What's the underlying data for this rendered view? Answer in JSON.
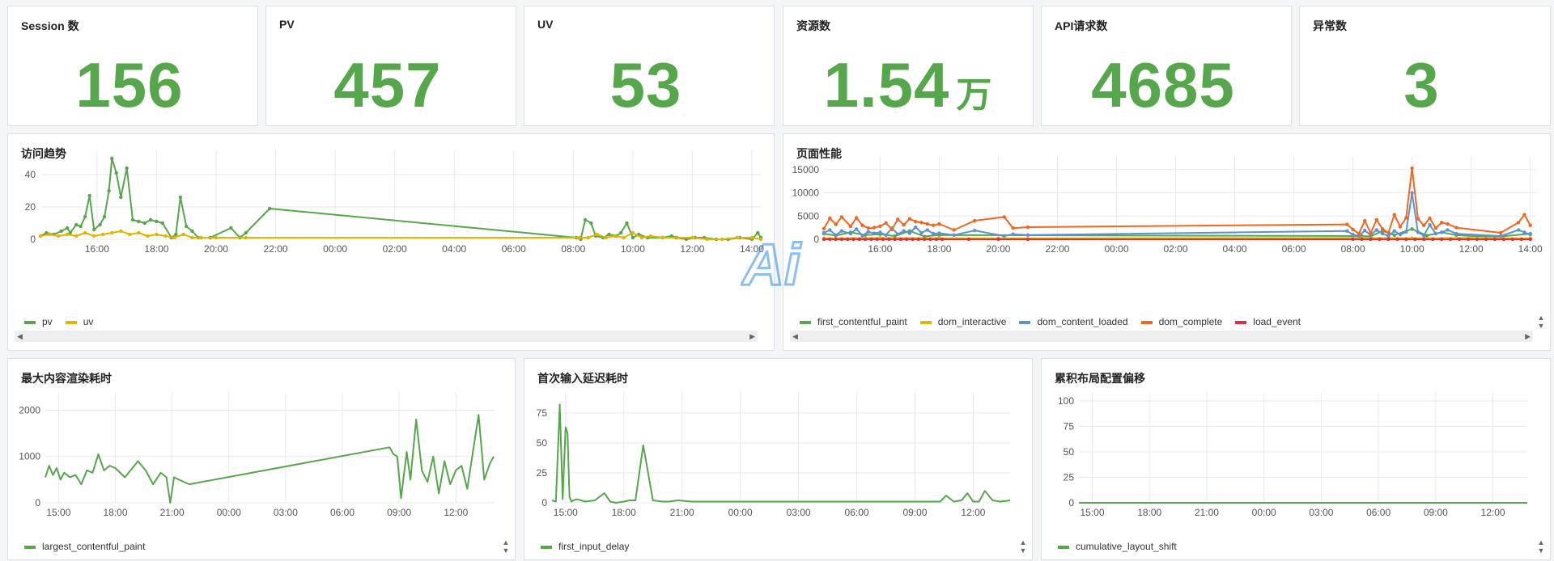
{
  "stats": [
    {
      "title": "Session 数",
      "value": "156",
      "unit": ""
    },
    {
      "title": "PV",
      "value": "457",
      "unit": ""
    },
    {
      "title": "UV",
      "value": "53",
      "unit": ""
    },
    {
      "title": "资源数",
      "value": "1.54",
      "unit": "万"
    },
    {
      "title": "API请求数",
      "value": "4685",
      "unit": ""
    },
    {
      "title": "异常数",
      "value": "3",
      "unit": ""
    }
  ],
  "colors": {
    "green": "#56a64b",
    "yellow": "#e0b400",
    "blue": "#5b92d6",
    "orange": "#f2661f",
    "red": "#e02f44",
    "panel_border": "#dcdfe3",
    "grid": "#e6e6e6"
  },
  "panels": {
    "visit": {
      "title": "访问趋势"
    },
    "perf": {
      "title": "页面性能"
    },
    "lcp": {
      "title": "最大内容渲染耗时"
    },
    "fid": {
      "title": "首次输入延迟耗时"
    },
    "cls": {
      "title": "累积布局配置偏移"
    }
  },
  "watermark": {
    "text": "Ai"
  },
  "chart_data": [
    {
      "id": "visit",
      "type": "line",
      "title": "访问趋势",
      "xlabel": "",
      "ylabel": "",
      "ylim": [
        0,
        50
      ],
      "yticks": [
        0,
        20,
        40
      ],
      "xtick_labels": [
        "16:00",
        "18:00",
        "20:00",
        "22:00",
        "00:00",
        "02:00",
        "04:00",
        "06:00",
        "08:00",
        "10:00",
        "12:00",
        "14:00"
      ],
      "xtick_hours": [
        16,
        18,
        20,
        22,
        24,
        26,
        28,
        30,
        32,
        34,
        36,
        38
      ],
      "xlim_hours": [
        14.1,
        38.3
      ],
      "legend": "bottom-left",
      "series": [
        {
          "name": "pv",
          "color": "#56a64b",
          "x": [
            14.1,
            14.3,
            14.55,
            14.8,
            15.0,
            15.1,
            15.3,
            15.45,
            15.6,
            15.75,
            15.9,
            16.1,
            16.25,
            16.4,
            16.5,
            16.65,
            16.8,
            17.0,
            17.2,
            17.4,
            17.6,
            17.8,
            18.0,
            18.2,
            18.5,
            18.65,
            18.8,
            19.0,
            19.2,
            19.4,
            19.8,
            20.5,
            20.8,
            21.0,
            21.8,
            32.1,
            32.25,
            32.4,
            32.6,
            32.75,
            33.0,
            33.2,
            33.45,
            33.6,
            33.8,
            34.0,
            34.2,
            34.5,
            35.0,
            35.3,
            35.45,
            35.8,
            36.1,
            36.4,
            36.8,
            37.2,
            37.6,
            38.0,
            38.2,
            38.3
          ],
          "y": [
            2,
            4,
            3,
            5,
            7,
            4,
            9,
            8,
            14,
            27,
            6,
            9,
            14,
            30,
            50,
            41,
            26,
            44,
            12,
            11,
            10,
            12,
            11,
            10,
            1,
            3,
            26,
            8,
            5,
            1,
            1,
            7,
            1,
            4,
            19,
            1,
            0,
            12,
            10,
            2,
            1,
            3,
            2,
            4,
            10,
            1,
            3,
            1,
            1,
            2,
            1,
            0,
            1,
            1,
            0,
            0,
            1,
            0,
            4,
            1
          ]
        },
        {
          "name": "uv",
          "color": "#e0b400",
          "x": [
            14.1,
            14.4,
            14.7,
            15.0,
            15.3,
            15.6,
            15.9,
            16.2,
            16.5,
            16.8,
            17.1,
            17.4,
            17.7,
            18.0,
            18.3,
            18.6,
            18.9,
            19.2,
            19.5,
            20.0,
            21.0,
            32.2,
            32.5,
            32.8,
            33.1,
            33.4,
            33.7,
            34.0,
            34.3,
            34.6,
            35.0,
            35.5,
            36.0,
            36.5,
            37.0,
            37.5,
            38.0,
            38.3
          ],
          "y": [
            2,
            3,
            2,
            3,
            2,
            4,
            2,
            3,
            4,
            5,
            3,
            4,
            2,
            3,
            2,
            1,
            3,
            1,
            1,
            1,
            1,
            1,
            1,
            3,
            1,
            2,
            1,
            4,
            1,
            2,
            1,
            1,
            1,
            0,
            0,
            1,
            1,
            0
          ]
        }
      ]
    },
    {
      "id": "perf",
      "type": "line",
      "title": "页面性能",
      "xlabel": "",
      "ylabel": "",
      "ylim": [
        0,
        16000
      ],
      "yticks": [
        0,
        5000,
        10000,
        15000
      ],
      "xtick_labels": [
        "16:00",
        "18:00",
        "20:00",
        "22:00",
        "00:00",
        "02:00",
        "04:00",
        "06:00",
        "08:00",
        "10:00",
        "12:00",
        "14:00"
      ],
      "xtick_hours": [
        16,
        18,
        20,
        22,
        24,
        26,
        28,
        30,
        32,
        34,
        36,
        38
      ],
      "xlim_hours": [
        14.1,
        38.2
      ],
      "legend": "bottom-left",
      "series": [
        {
          "name": "first_contentful_paint",
          "color": "#56a64b",
          "x": [
            14.1,
            14.5,
            15.0,
            15.5,
            16.0,
            16.5,
            17.0,
            17.5,
            18.0,
            32.3,
            32.6,
            33.0,
            33.4,
            34.0,
            34.5,
            35.0,
            35.5,
            36.0,
            37.0,
            38.0
          ],
          "y": [
            1200,
            800,
            1500,
            900,
            1100,
            700,
            1800,
            600,
            900,
            700,
            600,
            1800,
            900,
            2200,
            800,
            1500,
            900,
            700,
            600,
            1200
          ]
        },
        {
          "name": "dom_interactive",
          "color": "#e0b400",
          "x": [
            14.1,
            16.0,
            18.0,
            20.0,
            32.3,
            34.0,
            36.0,
            38.0
          ],
          "y": [
            200,
            300,
            250,
            200,
            300,
            250,
            300,
            200
          ]
        },
        {
          "name": "dom_content_loaded",
          "color": "#5b92d6",
          "x": [
            14.1,
            14.3,
            14.5,
            14.7,
            15.0,
            15.2,
            15.4,
            15.6,
            15.8,
            16.0,
            16.2,
            16.4,
            16.6,
            16.8,
            17.0,
            17.2,
            17.4,
            17.6,
            17.8,
            18.0,
            18.5,
            19.2,
            20.2,
            20.5,
            21.0,
            31.8,
            32.0,
            32.2,
            32.4,
            32.6,
            32.8,
            33.0,
            33.2,
            33.4,
            33.6,
            33.8,
            34.0,
            34.2,
            34.4,
            34.6,
            34.8,
            35.0,
            35.2,
            35.5,
            37.0,
            37.6,
            37.8,
            38.0
          ],
          "y": [
            1400,
            2000,
            900,
            1800,
            1200,
            2200,
            800,
            1600,
            1300,
            1500,
            900,
            2400,
            1100,
            1800,
            1300,
            2600,
            1400,
            2000,
            1200,
            1300,
            900,
            1900,
            700,
            1100,
            900,
            1800,
            1000,
            700,
            1900,
            900,
            2000,
            1200,
            700,
            1800,
            1000,
            1600,
            10000,
            1500,
            800,
            3100,
            1200,
            1500,
            2000,
            1200,
            700,
            2000,
            1500,
            1000
          ]
        },
        {
          "name": "dom_complete",
          "color": "#f2661f",
          "x": [
            14.1,
            14.3,
            14.5,
            14.7,
            15.0,
            15.2,
            15.4,
            15.6,
            15.8,
            16.0,
            16.2,
            16.4,
            16.6,
            16.8,
            17.0,
            17.2,
            17.4,
            17.6,
            17.8,
            18.0,
            18.5,
            19.2,
            20.2,
            20.5,
            21.0,
            31.8,
            32.0,
            32.2,
            32.4,
            32.6,
            32.8,
            33.0,
            33.2,
            33.4,
            33.6,
            33.8,
            34.0,
            34.2,
            34.4,
            34.6,
            34.8,
            35.0,
            35.2,
            35.5,
            37.0,
            37.6,
            37.8,
            38.0
          ],
          "y": [
            2300,
            4500,
            3200,
            4800,
            2800,
            4600,
            3000,
            2400,
            2500,
            2800,
            3500,
            2100,
            4300,
            3100,
            4400,
            3800,
            3600,
            3300,
            3000,
            3300,
            2000,
            4000,
            4800,
            2400,
            2600,
            3200,
            2100,
            1200,
            4000,
            1300,
            4200,
            2200,
            1400,
            5300,
            2700,
            4600,
            15300,
            4400,
            3000,
            4500,
            2400,
            3600,
            3300,
            2500,
            1400,
            3600,
            5300,
            3000
          ]
        },
        {
          "name": "load_event",
          "color": "#e02f44",
          "x": [
            14.1,
            14.3,
            14.5,
            14.7,
            14.9,
            15.1,
            15.3,
            15.5,
            15.7,
            15.9,
            16.1,
            16.3,
            16.5,
            16.7,
            16.9,
            17.1,
            17.3,
            17.5,
            17.7,
            17.9,
            18.1,
            19.0,
            20.0,
            21.0,
            32.0,
            32.3,
            32.6,
            32.9,
            33.2,
            33.5,
            33.8,
            34.1,
            34.4,
            34.7,
            35.0,
            35.3,
            35.6,
            35.9,
            36.2,
            36.5,
            36.8,
            37.1,
            37.4,
            37.7,
            38.0
          ],
          "y": [
            0,
            0,
            0,
            0,
            0,
            0,
            0,
            0,
            0,
            0,
            0,
            0,
            0,
            0,
            0,
            0,
            0,
            0,
            0,
            0,
            0,
            0,
            0,
            0,
            0,
            0,
            0,
            0,
            0,
            0,
            0,
            0,
            0,
            0,
            0,
            0,
            0,
            0,
            0,
            0,
            0,
            0,
            0,
            0,
            0
          ]
        }
      ]
    },
    {
      "id": "lcp",
      "type": "line",
      "title": "最大内容渲染耗时",
      "xlabel": "",
      "ylabel": "",
      "ylim": [
        0,
        2200
      ],
      "yticks": [
        0,
        1000,
        2000
      ],
      "xtick_labels": [
        "15:00",
        "18:00",
        "21:00",
        "00:00",
        "03:00",
        "06:00",
        "09:00",
        "12:00"
      ],
      "xtick_hours": [
        15,
        18,
        21,
        24,
        27,
        30,
        33,
        36
      ],
      "xlim_hours": [
        14.3,
        38.0
      ],
      "legend": "bottom-left",
      "series": [
        {
          "name": "largest_contentful_paint",
          "color": "#56a64b",
          "x": [
            14.3,
            14.5,
            14.7,
            14.9,
            15.1,
            15.3,
            15.6,
            15.9,
            16.2,
            16.5,
            16.8,
            17.1,
            17.4,
            17.7,
            18.0,
            18.5,
            19.2,
            19.6,
            20.0,
            20.4,
            20.7,
            20.9,
            21.1,
            21.9,
            32.5,
            32.7,
            32.9,
            33.1,
            33.4,
            33.6,
            33.9,
            34.2,
            34.5,
            34.8,
            35.1,
            35.4,
            35.7,
            36.0,
            36.3,
            36.6,
            37.2,
            37.5,
            37.8,
            38.0
          ],
          "y": [
            550,
            800,
            600,
            750,
            500,
            650,
            550,
            600,
            400,
            700,
            650,
            1050,
            700,
            800,
            750,
            550,
            900,
            700,
            400,
            650,
            550,
            0,
            550,
            400,
            1200,
            1050,
            1000,
            100,
            1100,
            500,
            1800,
            700,
            450,
            1000,
            200,
            900,
            400,
            700,
            800,
            300,
            1900,
            500,
            850,
            1000
          ]
        }
      ]
    },
    {
      "id": "fid",
      "type": "line",
      "title": "首次输入延迟耗时",
      "xlabel": "",
      "ylabel": "",
      "ylim": [
        0,
        85
      ],
      "yticks": [
        0,
        25,
        50,
        75
      ],
      "xtick_labels": [
        "15:00",
        "18:00",
        "21:00",
        "00:00",
        "03:00",
        "06:00",
        "09:00",
        "12:00"
      ],
      "xtick_hours": [
        15,
        18,
        21,
        24,
        27,
        30,
        33,
        36
      ],
      "xlim_hours": [
        14.3,
        37.9
      ],
      "legend": "bottom-left",
      "series": [
        {
          "name": "first_input_delay",
          "color": "#56a64b",
          "x": [
            14.3,
            14.5,
            14.7,
            14.85,
            15.0,
            15.1,
            15.2,
            15.3,
            15.4,
            15.6,
            16.0,
            16.5,
            17.0,
            17.3,
            17.6,
            18.0,
            18.3,
            18.6,
            19.0,
            19.5,
            20.0,
            20.3,
            20.8,
            21.5,
            34.0,
            34.3,
            34.6,
            35.0,
            35.4,
            35.7,
            36.0,
            36.3,
            36.6,
            37.0,
            37.4,
            37.9
          ],
          "y": [
            2,
            1,
            82,
            3,
            63,
            58,
            5,
            1,
            2,
            3,
            1,
            2,
            8,
            1,
            0,
            1,
            2,
            2,
            48,
            2,
            1,
            1,
            2,
            1,
            1,
            1,
            6,
            1,
            2,
            8,
            1,
            1,
            10,
            2,
            1,
            2
          ]
        }
      ]
    },
    {
      "id": "cls",
      "type": "line",
      "title": "累积布局配置偏移",
      "xlabel": "",
      "ylabel": "",
      "ylim": [
        0,
        100
      ],
      "yticks": [
        0,
        25,
        50,
        75,
        100
      ],
      "xtick_labels": [
        "15:00",
        "18:00",
        "21:00",
        "00:00",
        "03:00",
        "06:00",
        "09:00",
        "12:00"
      ],
      "xtick_hours": [
        15,
        18,
        21,
        24,
        27,
        30,
        33,
        36
      ],
      "xlim_hours": [
        14.3,
        37.8
      ],
      "legend": "bottom-left",
      "series": [
        {
          "name": "cumulative_layout_shift",
          "color": "#56a64b",
          "x": [
            14.3,
            37.8
          ],
          "y": [
            0,
            0
          ]
        }
      ]
    }
  ]
}
